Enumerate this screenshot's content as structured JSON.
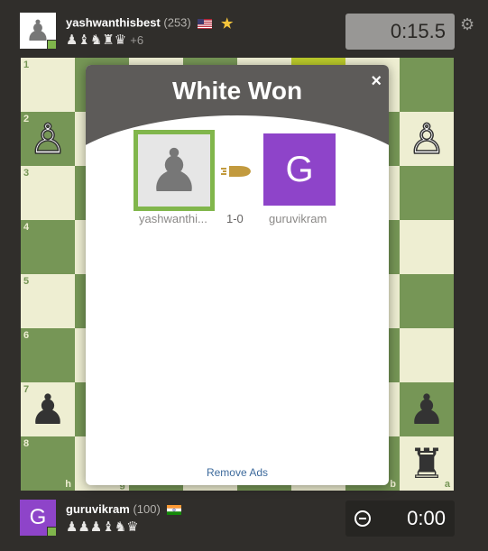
{
  "top_player": {
    "avatar_glyph": "♟",
    "name": "yashwanthisbest",
    "rating": "(253)",
    "flag": "us-flag-icon",
    "captured": "♟♝♞♜♛",
    "captured_plus": "+6",
    "clock": "0:15.5"
  },
  "bottom_player": {
    "avatar_letter": "G",
    "name": "guruvikram",
    "rating": "(100)",
    "flag": "india-flag-icon",
    "captured": "♟♟♟♝♞♛",
    "clock": "0:00"
  },
  "board": {
    "ranks": [
      "1",
      "2",
      "3",
      "4",
      "5",
      "6",
      "7",
      "8"
    ],
    "files_visible": [
      "h",
      "g",
      "b",
      "a"
    ],
    "pieces": [
      {
        "rank": "2",
        "file": "h",
        "glyph": "♙",
        "color": "w"
      },
      {
        "rank": "2",
        "file": "a",
        "glyph": "♙",
        "color": "w"
      },
      {
        "rank": "7",
        "file": "h",
        "glyph": "♟",
        "color": "b"
      },
      {
        "rank": "7",
        "file": "a",
        "glyph": "♟",
        "color": "b"
      },
      {
        "rank": "8",
        "file": "a",
        "glyph": "♜",
        "color": "b"
      }
    ],
    "light_color": "#eeeed2",
    "dark_color": "#769656"
  },
  "modal": {
    "title": "White Won",
    "close": "×",
    "winner_name": "yashwanthi...",
    "loser_name": "guruvikram",
    "loser_letter": "G",
    "score": "1-0",
    "time_control_icon": "bullet-icon",
    "footer_link": "Remove Ads"
  },
  "colors": {
    "accent_green": "#81b64c",
    "avatar_purple": "#8e44c9",
    "background": "#302e2b"
  }
}
